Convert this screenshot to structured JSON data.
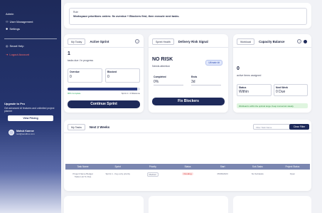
{
  "sidebar": {
    "items": [
      {
        "label": "Admin",
        "icon": "admin-icon"
      },
      {
        "label": "User Management",
        "icon": "users-icon"
      },
      {
        "label": "Settings",
        "icon": "gear-icon"
      },
      {
        "label": "Smart Help",
        "icon": "help-icon"
      },
      {
        "label": "Logout Account",
        "icon": "logout-icon"
      }
    ],
    "upgrade": {
      "title": "Upgrade to Pro",
      "description": "Get advanced AI features and unlimited project planner",
      "button": "View Pricing"
    },
    "user": {
      "name": "Mahuk Kanroe",
      "email": "test@sandbox.com"
    }
  },
  "note": {
    "label": "Rule",
    "text": "Workspace prioritizes orders: fix overdue + Blockers first, then execute next tasks."
  },
  "sprint_card": {
    "tab": "My Today",
    "title": "Active Sprint",
    "count": "1",
    "subtitle": "tasks due / in progress",
    "overdue_label": "Overdue",
    "overdue_value": "0",
    "blocked_label": "Blocked",
    "blocked_value": "0",
    "progress": 0.96,
    "progress_left": "96% Complete",
    "progress_right": "Sprint 1 / 4 Milestone",
    "button": "Continue Sprint"
  },
  "health_card": {
    "tab": "Sprint Health",
    "title": "Delivery Risk Signal",
    "status": "NO RISK",
    "subtitle": "Needs attention",
    "badge": "Ultimate kit",
    "completed_label": "Completed",
    "completed_value": "0%",
    "ends_label": "Ends",
    "ends_value": "3d",
    "button": "Fix Blockers"
  },
  "capacity_card": {
    "tab": "Workload",
    "title": "Capacity Balance",
    "count": "0",
    "subtitle": "active items assigned",
    "status_label": "Status",
    "status_value": "Within",
    "next_label": "Next Week",
    "next_value": "0 Due",
    "note": "Workload is within the optimal range. Keep momentum steady."
  },
  "tasks": {
    "tab": "My Tasks",
    "title": "Next 2 Weeks",
    "search_placeholder": "Filter Task Name",
    "clear_button": "Clear Filter",
    "columns": [
      "Task Name",
      "Sprint",
      "Priority",
      "Status",
      "Start",
      "Sub-Tasks",
      "Project Status"
    ],
    "rows": [
      {
        "name": "Project Name Budget",
        "name2": "Tasks List To Due",
        "sprint": "Sprint 1 - Key-only priority",
        "priority": "Medium",
        "status": "Pending",
        "start": "05/09/2023",
        "subtasks": "No Subtasks",
        "project_status": "Open"
      }
    ]
  },
  "colors": {
    "brand": "#1e2a5a",
    "accent_green": "#22a35a",
    "danger": "#ff6a6a"
  }
}
